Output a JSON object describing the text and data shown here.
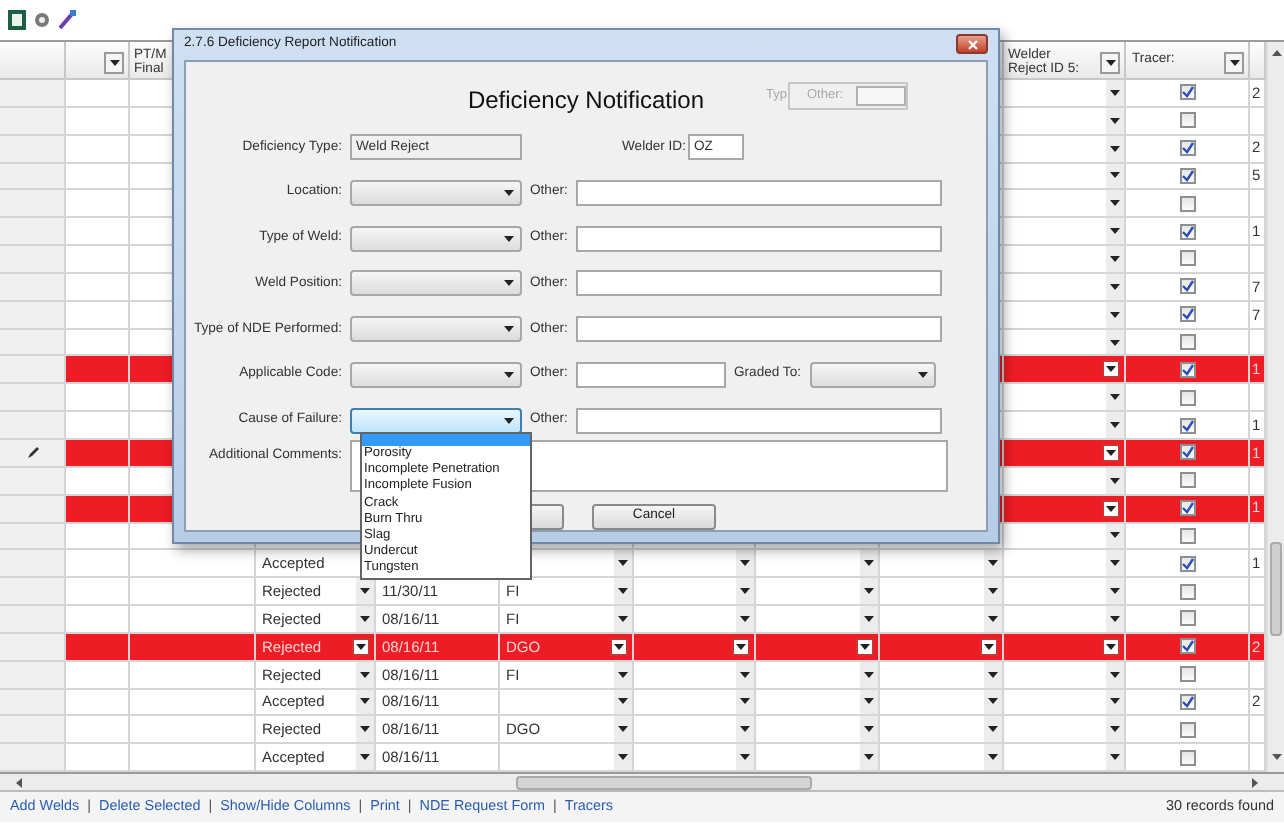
{
  "grid": {
    "header": {
      "pt_m_final": "PT/M Final",
      "welder_reject_id_5": "Welder Reject ID 5:",
      "tracer": "Tracer:"
    },
    "rows": [
      {
        "tracer": true,
        "flagged": false,
        "editing": false,
        "column_11": "2"
      },
      {
        "tracer": false,
        "flagged": false,
        "editing": false
      },
      {
        "tracer": true,
        "flagged": false,
        "editing": false,
        "column_11": "2"
      },
      {
        "tracer": true,
        "flagged": false,
        "editing": false,
        "column_11": "5"
      },
      {
        "tracer": false,
        "flagged": false,
        "editing": false
      },
      {
        "tracer": true,
        "flagged": false,
        "editing": false,
        "column_11": "1"
      },
      {
        "tracer": false,
        "flagged": false,
        "editing": false
      },
      {
        "tracer": true,
        "flagged": false,
        "editing": false,
        "column_11": "7"
      },
      {
        "tracer": true,
        "flagged": false,
        "editing": false,
        "column_11": "7"
      },
      {
        "tracer": false,
        "flagged": false,
        "editing": false
      },
      {
        "tracer": true,
        "flagged": true,
        "editing": false,
        "column_11": "1"
      },
      {
        "tracer": false,
        "flagged": false,
        "editing": false
      },
      {
        "tracer": true,
        "flagged": false,
        "editing": false,
        "column_11": "1"
      },
      {
        "tracer": true,
        "flagged": true,
        "editing": true,
        "column_11": "1"
      },
      {
        "tracer": false,
        "flagged": false,
        "editing": false
      },
      {
        "tracer": true,
        "flagged": true,
        "editing": false,
        "column_11": "1"
      },
      {
        "tracer": false,
        "flagged": false,
        "editing": false
      },
      {
        "tracer": true,
        "flagged": false,
        "editing": false,
        "column_11": "1",
        "status": "Accepted"
      },
      {
        "tracer": false,
        "flagged": false,
        "editing": false,
        "status": "Rejected",
        "date": "11/30/11",
        "code": "FI"
      },
      {
        "tracer": false,
        "flagged": false,
        "editing": false,
        "status": "Rejected",
        "date": "08/16/11",
        "code": "FI"
      },
      {
        "tracer": true,
        "flagged": true,
        "editing": false,
        "column_11": "2",
        "status": "Rejected",
        "date": "08/16/11",
        "code": "DGO"
      },
      {
        "tracer": false,
        "flagged": false,
        "editing": false,
        "status": "Rejected",
        "date": "08/16/11",
        "code": "FI"
      },
      {
        "tracer": true,
        "flagged": false,
        "editing": false,
        "column_11": "2",
        "status": "Accepted",
        "date": "08/16/11"
      },
      {
        "tracer": false,
        "flagged": false,
        "editing": false,
        "status": "Rejected",
        "date": "08/16/11",
        "code": "DGO"
      },
      {
        "tracer": false,
        "flagged": false,
        "editing": false,
        "status": "Accepted",
        "date": "08/16/11"
      }
    ]
  },
  "dialog": {
    "title": "2.7.6 Deficiency Report Notification",
    "heading": "Deficiency Notification",
    "type_label": "Typ",
    "other_group_label": "Other:",
    "deficiency_type": {
      "label": "Deficiency Type:",
      "value": "Weld Reject"
    },
    "welder_id": {
      "label": "Welder ID:",
      "value": "OZ"
    },
    "combo_rows": [
      {
        "kind": "other",
        "label": "Location:",
        "focused": false,
        "other_label": "Other:"
      },
      {
        "kind": "other",
        "label": "Type of Weld:",
        "focused": false,
        "other_label": "Other:"
      },
      {
        "kind": "other",
        "label": "Weld Position:",
        "focused": false,
        "other_label": "Other:"
      },
      {
        "kind": "other",
        "label": "Type of NDE Performed:",
        "focused": false,
        "other_label": "Other:"
      },
      {
        "kind": "graded",
        "label": "Applicable Code:",
        "focused": false,
        "other_label": "Other:",
        "graded_label": "Graded To:"
      },
      {
        "kind": "other",
        "label": "Cause of Failure:",
        "focused": true,
        "other_label": "Other:"
      }
    ],
    "comments_label": "Additional Comments:",
    "buttons": [
      {
        "kind": "hidden_label"
      },
      {
        "kind": "labelled",
        "label": "Cancel"
      }
    ],
    "dropdown_list": {
      "blank_option_highlighted": true,
      "options": [
        "Porosity",
        "Incomplete Penetration",
        "Incomplete Fusion",
        "Crack",
        "Burn Thru",
        "Slag",
        "Undercut",
        "Tungsten"
      ]
    }
  },
  "footer": {
    "links": [
      "Add Welds",
      "Delete Selected",
      "Show/Hide Columns",
      "Print",
      "NDE Request Form",
      "Tracers"
    ],
    "separator": "|",
    "record_count": "30 records found"
  }
}
